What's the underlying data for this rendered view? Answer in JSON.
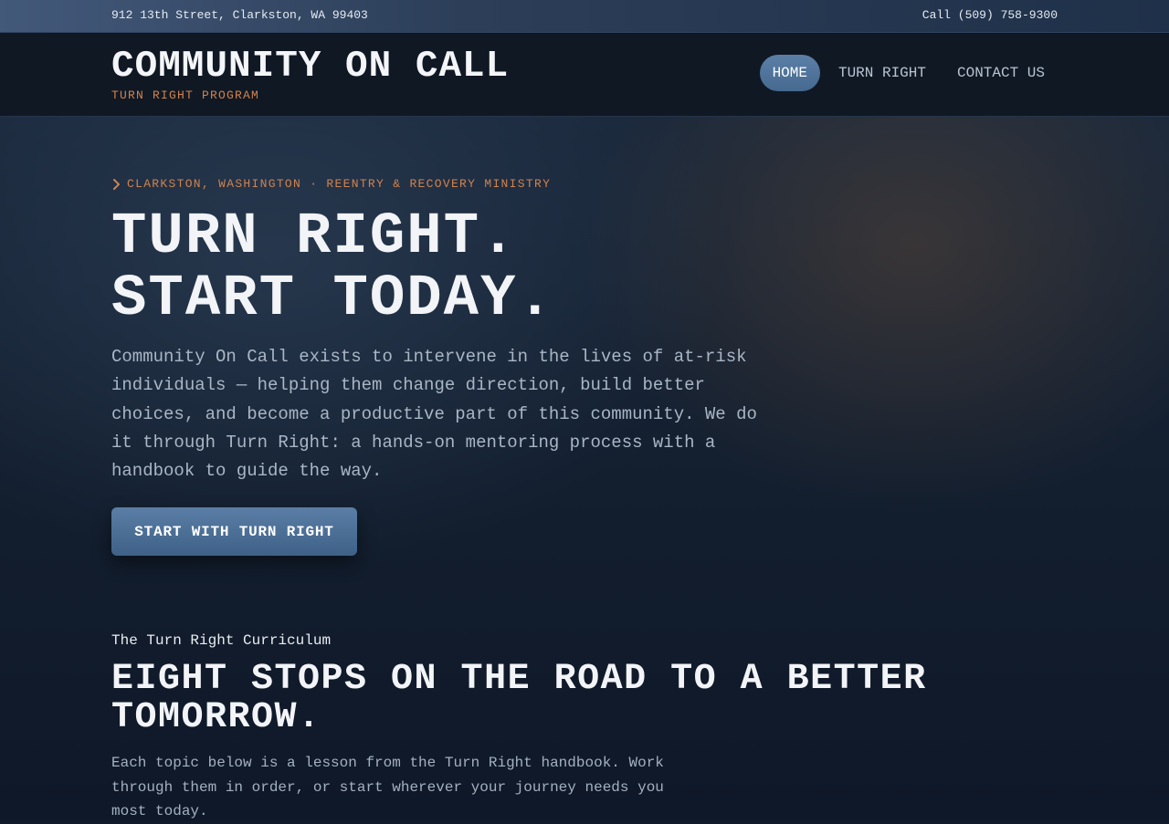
{
  "topbar": {
    "address": "912 13th Street, Clarkston, WA 99403",
    "phone": "Call (509) 758-9300"
  },
  "header": {
    "title": "COMMUNITY ON CALL",
    "subtitle": "TURN RIGHT PROGRAM"
  },
  "nav": {
    "items": [
      {
        "label": "HOME",
        "active": true
      },
      {
        "label": "TURN RIGHT",
        "active": false
      },
      {
        "label": "CONTACT US",
        "active": false
      }
    ]
  },
  "hero": {
    "eyebrow_icon": "chevron-right-icon",
    "eyebrow": "CLARKSTON, WASHINGTON · REENTRY & RECOVERY MINISTRY",
    "title_line1": "TURN RIGHT.",
    "title_line2": "START TODAY.",
    "body": "Community On Call exists to intervene in the lives of at-risk individuals — helping them change direction, build better choices, and become a productive part of this community. We do it through Turn Right: a hands-on mentoring process with a handbook to guide the way.",
    "cta_label": "START WITH TURN RIGHT"
  },
  "curriculum": {
    "label": "The Turn Right Curriculum",
    "title": "EIGHT STOPS ON THE ROAD TO A BETTER TOMORROW.",
    "body": "Each topic below is a lesson from the Turn Right handbook. Work through them in order, or start wherever your journey needs you most today."
  },
  "colors": {
    "accent_orange": "#d0834e",
    "button_blue": "#4f7399",
    "background": "#101a29"
  }
}
